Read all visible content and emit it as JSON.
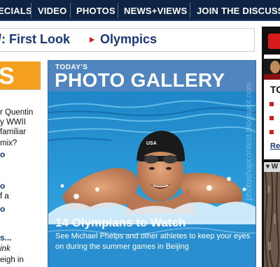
{
  "nav": {
    "items": [
      {
        "label": "ECIALS"
      },
      {
        "label": "VIDEO"
      },
      {
        "label": "PHOTOS"
      },
      {
        "label": "NEWS+VIEWS"
      },
      {
        "label": "JOIN THE DISCUSSI"
      }
    ]
  },
  "headline_links": {
    "first": "/: First Look",
    "second": "Olympics"
  },
  "left_column": {
    "orange_label": "S",
    "lines": [
      "r Quentin",
      "y WWII",
      "familiar",
      "mix?",
      "o",
      "o",
      "f a",
      "o",
      "s...",
      "ink",
      "eigh in"
    ]
  },
  "gallery": {
    "kicker": "TODAY'S",
    "title": "PHOTO GALLERY",
    "caption_title": "14 Olympians to Watch",
    "caption_desc": "See Michael Phelps and other athletes to keep your eyes on during the summer games in Beijing",
    "watermark": "photoshopcontest.blogspot.com"
  },
  "right_column": {
    "heading": "TO",
    "link": "Rea",
    "bar_label": "▾ W"
  },
  "colors": {
    "nav_bg": "#0d2444",
    "link_blue": "#17377a",
    "accent_red": "#d41a1a",
    "orange": "#f5a01e",
    "card_blue": "#4f86c0"
  }
}
